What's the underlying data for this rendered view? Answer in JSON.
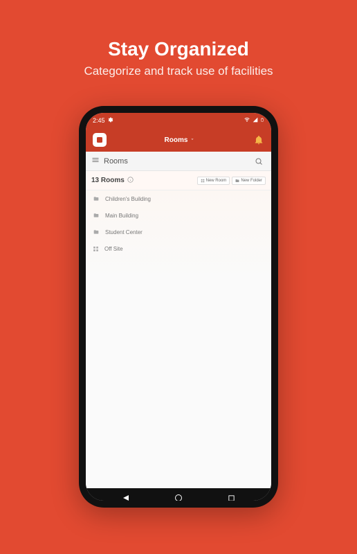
{
  "promo": {
    "title": "Stay Organized",
    "subtitle": "Categorize and track use of facilities"
  },
  "status": {
    "time": "2:45"
  },
  "header": {
    "title": "Rooms"
  },
  "section": {
    "title": "Rooms"
  },
  "count": {
    "label": "13 Rooms",
    "new_room": "New Room",
    "new_folder": "New Folder"
  },
  "items": [
    {
      "label": "Children's Building",
      "type": "folder"
    },
    {
      "label": "Main Building",
      "type": "folder"
    },
    {
      "label": "Student Center",
      "type": "folder"
    },
    {
      "label": "Off Site",
      "type": "grid"
    }
  ]
}
